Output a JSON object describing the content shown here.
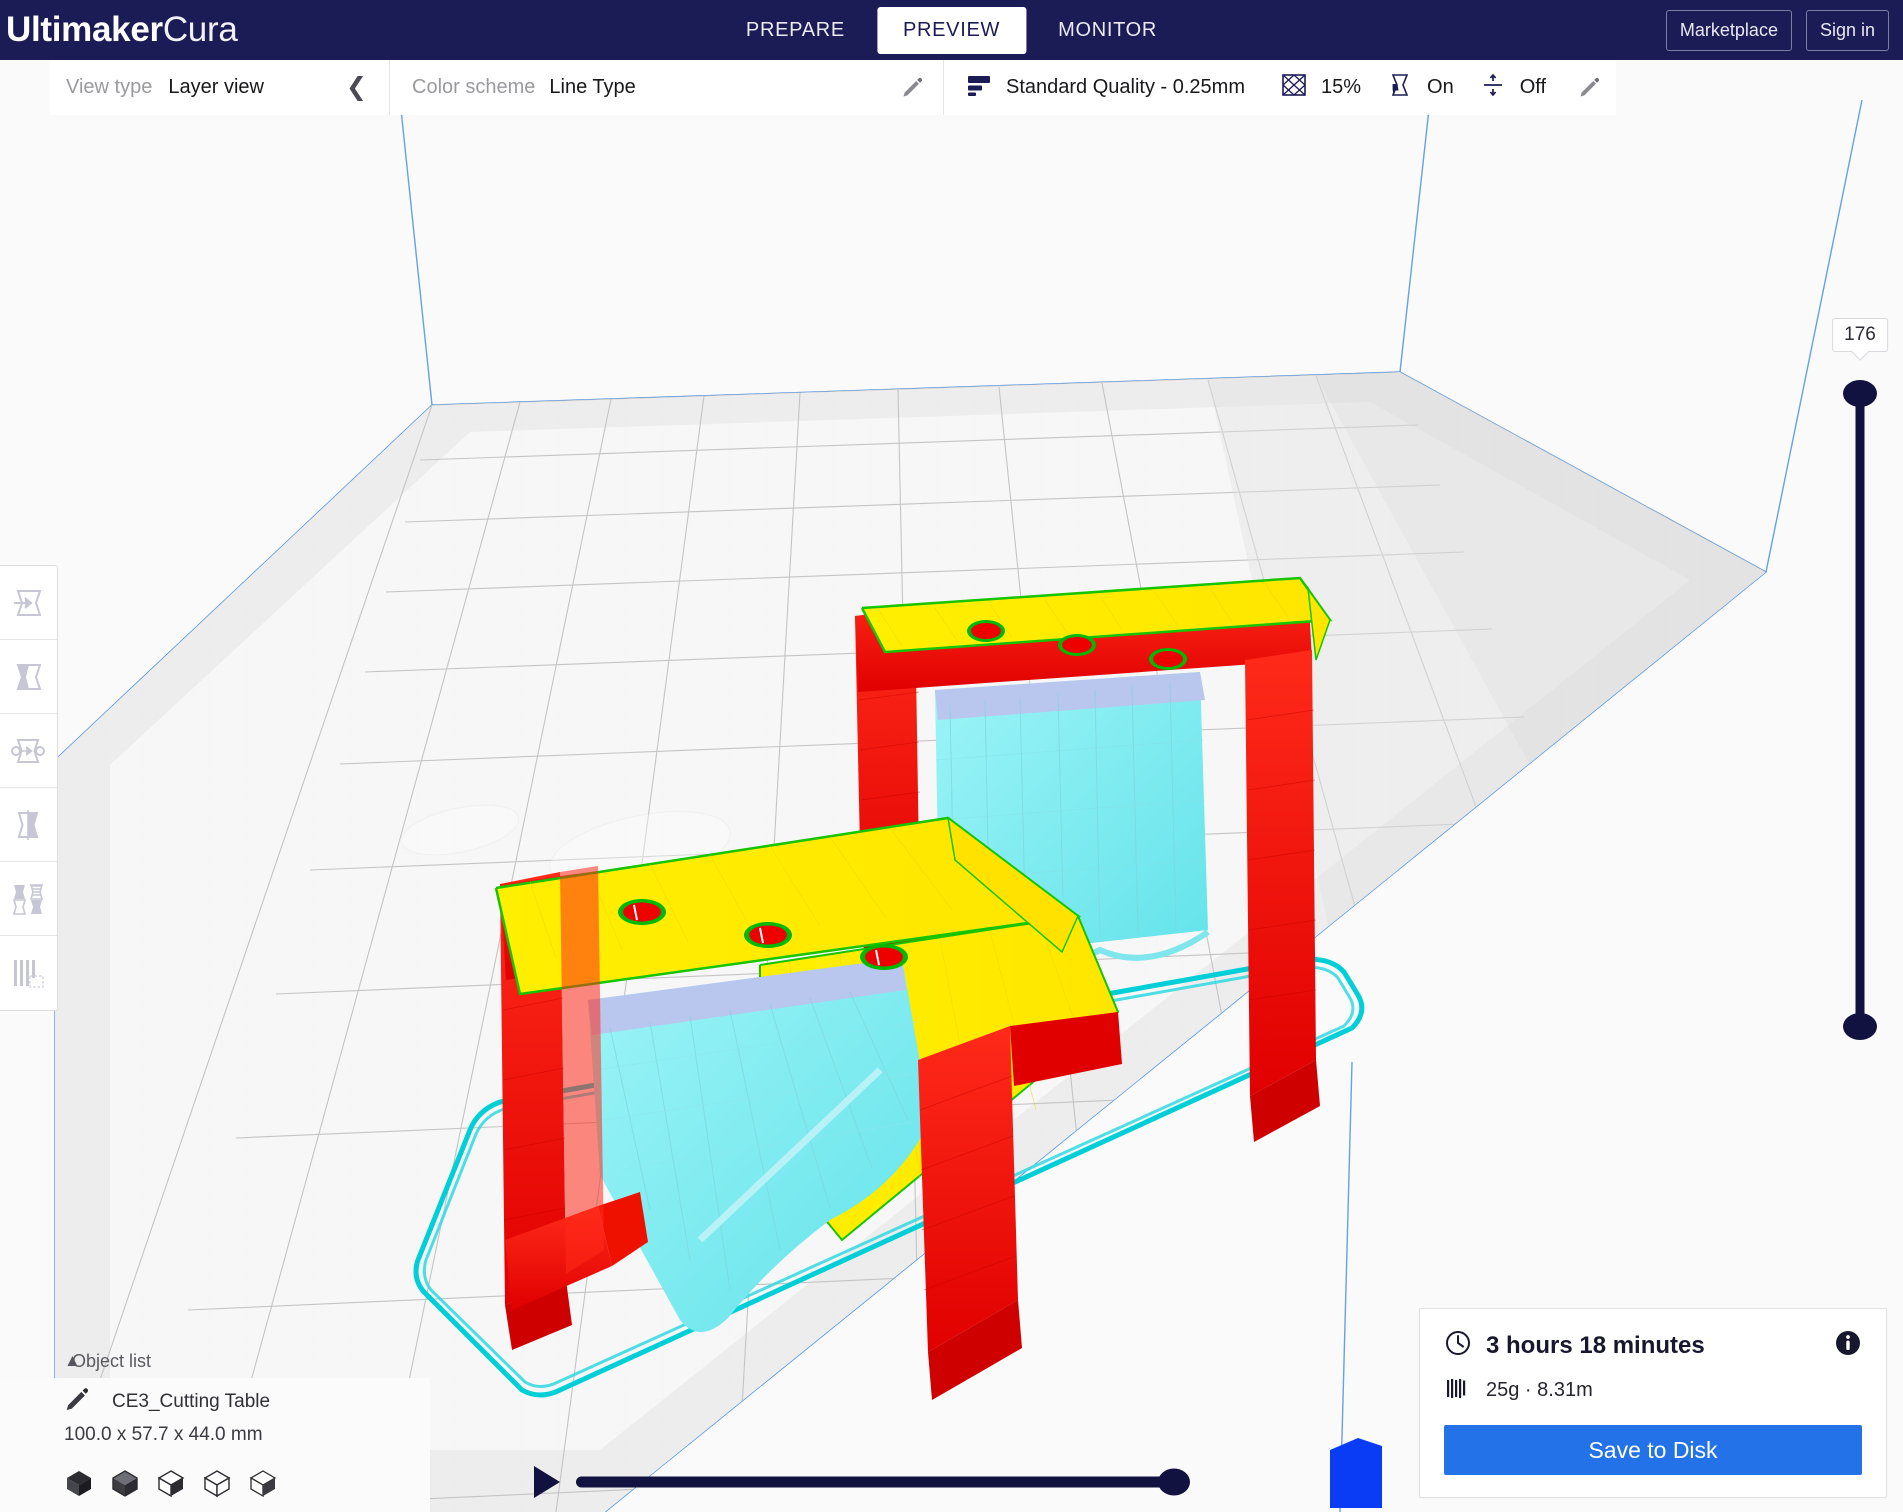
{
  "app": {
    "brand_bold": "Ultimaker",
    "brand_light": "Cura"
  },
  "tabs": [
    {
      "label": "PREPARE",
      "active": false
    },
    {
      "label": "PREVIEW",
      "active": true
    },
    {
      "label": "MONITOR",
      "active": false
    }
  ],
  "account": {
    "marketplace_label": "Marketplace",
    "signin_label": "Sign in"
  },
  "view_settings": {
    "view_type_label": "View type",
    "view_type_value": "Layer view",
    "collapse_icon": "chevron-left-icon",
    "color_scheme_label": "Color scheme",
    "color_scheme_value": "Line Type",
    "edit_icon": "pencil-icon"
  },
  "print_settings": {
    "profile_icon": "quality-lines-icon",
    "profile_label": "Standard Quality - 0.25mm",
    "infill_icon": "infill-icon",
    "infill_value": "15%",
    "support_icon": "support-icon",
    "support_value": "On",
    "adhesion_icon": "adhesion-icon",
    "adhesion_value": "Off",
    "edit_icon": "pencil-icon"
  },
  "left_tools": [
    {
      "name": "move-tool",
      "icon": "move-icon"
    },
    {
      "name": "scale-tool",
      "icon": "scale-icon"
    },
    {
      "name": "rotate-tool",
      "icon": "rotate-icon"
    },
    {
      "name": "mirror-tool",
      "icon": "mirror-icon"
    },
    {
      "name": "per-model-settings-tool",
      "icon": "per-model-settings-icon"
    },
    {
      "name": "support-blocker-tool",
      "icon": "support-blocker-icon"
    }
  ],
  "object_list": {
    "header_label": "Object list",
    "caret_icon": "chevron-up-icon",
    "item_icon": "pencil-icon",
    "item_name": "CE3_Cutting Table",
    "dimensions": "100.0 x 57.7 x 44.0 mm",
    "view_icons": [
      "solid-view-icon",
      "shaded-view-icon",
      "outline-view-icon",
      "wireframe-view-icon",
      "transparent-view-icon"
    ]
  },
  "print_info": {
    "time_icon": "clock-icon",
    "time_value": "3 hours 18 minutes",
    "material_icon": "filament-icon",
    "material_value": "25g · 8.31m",
    "info_icon": "info-icon",
    "save_label": "Save to Disk"
  },
  "layer_slider": {
    "value": "176",
    "max": "176",
    "min": "1"
  },
  "path_slider": {
    "play_icon": "play-icon",
    "position_percent": 100
  },
  "colors": {
    "brand_navy": "#1b1b56",
    "accent_blue": "#2472e8",
    "slider_navy": "#121240",
    "viewport_bg": "#fafafa",
    "buildplate": "#efefef",
    "buildplate_edge": "#4a90e2",
    "line_wall_outer": "#ff0000",
    "line_wall_inner": "#00b200",
    "line_skin": "#ffff00",
    "line_support": "#6effff",
    "line_travel": "#00d0d0",
    "line_infill": "#6a8cff"
  },
  "scene": {
    "model_name": "CE3_Cutting Table",
    "legend_note": "Line Type color scheme: red = outer wall, green = inner wall, yellow = top/bottom skin, cyan = support, teal = skirt/travel"
  }
}
